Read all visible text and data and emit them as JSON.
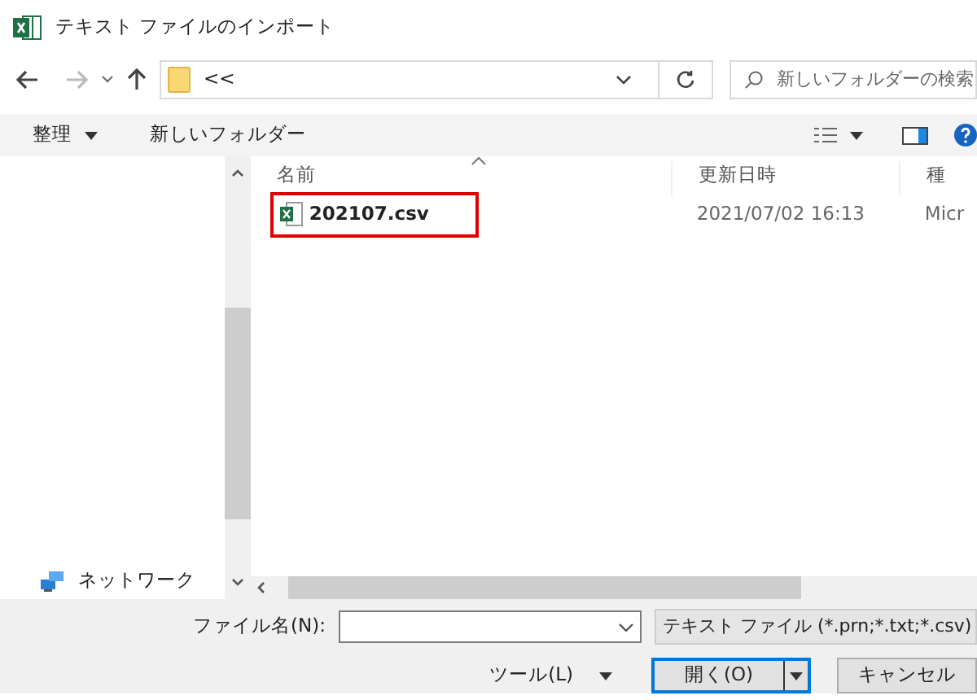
{
  "window": {
    "title": "テキスト ファイルのインポート"
  },
  "address_bar": {
    "path": "<<",
    "search_placeholder": "新しいフォルダーの検索"
  },
  "toolbar": {
    "organize": "整理",
    "new_folder": "新しいフォルダー"
  },
  "file_list": {
    "columns": [
      "名前",
      "更新日時",
      "種"
    ],
    "rows": [
      {
        "name": "202107.csv",
        "modified": "2021/07/02 16:13",
        "type": "Micr",
        "highlighted": true
      }
    ]
  },
  "sidebar": {
    "items": [
      {
        "label": "ネットワーク"
      }
    ]
  },
  "footer": {
    "file_name_label": "ファイル名(N):",
    "file_type": "テキスト ファイル (*.prn;*.txt;*.csv)",
    "tools": "ツール(L)",
    "open": "開く(O)",
    "cancel": "キャンセル"
  }
}
